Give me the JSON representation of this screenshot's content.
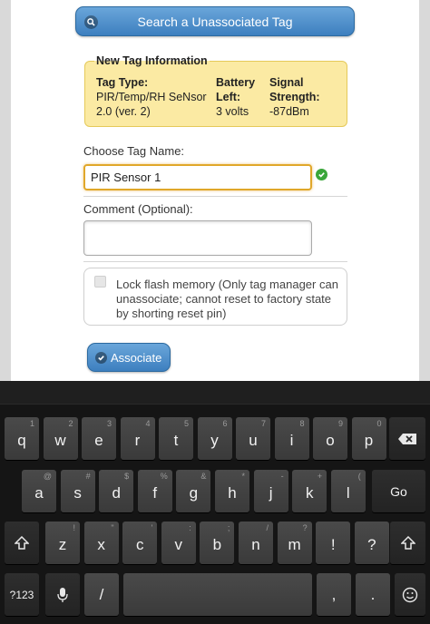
{
  "search_button": {
    "label": "Search a Unassociated Tag",
    "icon": "search-icon"
  },
  "tag_info": {
    "legend": "New Tag Information",
    "type_label": "Tag Type:",
    "type_line1": "PIR/Temp/RH SeNsor",
    "type_line2": "2.0 (ver. 2)",
    "battery_label_1": "Battery",
    "battery_label_2": "Left:",
    "battery_value": "3 volts",
    "signal_label_1": "Signal",
    "signal_label_2": "Strength:",
    "signal_value": "-87dBm"
  },
  "tag_name": {
    "label": "Choose Tag Name:",
    "value": "PIR Sensor 1",
    "status_icon": "valid-check-icon"
  },
  "comment": {
    "label": "Comment (Optional):",
    "value": ""
  },
  "lock_flash": {
    "label": "Lock flash memory (Only tag manager can unassociate; cannot reset to factory state by shorting reset pin)",
    "checked": false
  },
  "associate_button": {
    "label": "Associate",
    "icon": "checkmark-icon"
  },
  "keyboard": {
    "row1": [
      {
        "key": "q",
        "sub": "1"
      },
      {
        "key": "w",
        "sub": "2"
      },
      {
        "key": "e",
        "sub": "3"
      },
      {
        "key": "r",
        "sub": "4"
      },
      {
        "key": "t",
        "sub": "5"
      },
      {
        "key": "y",
        "sub": "6"
      },
      {
        "key": "u",
        "sub": "7"
      },
      {
        "key": "i",
        "sub": "8"
      },
      {
        "key": "o",
        "sub": "9"
      },
      {
        "key": "p",
        "sub": "0"
      }
    ],
    "row2": [
      {
        "key": "a",
        "sub": "@"
      },
      {
        "key": "s",
        "sub": "#"
      },
      {
        "key": "d",
        "sub": "$"
      },
      {
        "key": "f",
        "sub": "%"
      },
      {
        "key": "g",
        "sub": "&"
      },
      {
        "key": "h",
        "sub": "*"
      },
      {
        "key": "j",
        "sub": "-"
      },
      {
        "key": "k",
        "sub": "+"
      },
      {
        "key": "l",
        "sub": "("
      }
    ],
    "row3": [
      {
        "key": "z",
        "sub": "!"
      },
      {
        "key": "x",
        "sub": "\""
      },
      {
        "key": "c",
        "sub": "'"
      },
      {
        "key": "v",
        "sub": ":"
      },
      {
        "key": "b",
        "sub": ";"
      },
      {
        "key": "n",
        "sub": "/"
      },
      {
        "key": "m",
        "sub": "?"
      },
      {
        "key": "!",
        "sub": ""
      },
      {
        "key": "?",
        "sub": ""
      }
    ],
    "go_label": "Go",
    "symbols_label": "?123",
    "slash_label": "/",
    "comma_label": ",",
    "period_label": ".",
    "icons": [
      "backspace-icon",
      "shift-icon",
      "microphone-icon",
      "emoji-icon"
    ]
  }
}
